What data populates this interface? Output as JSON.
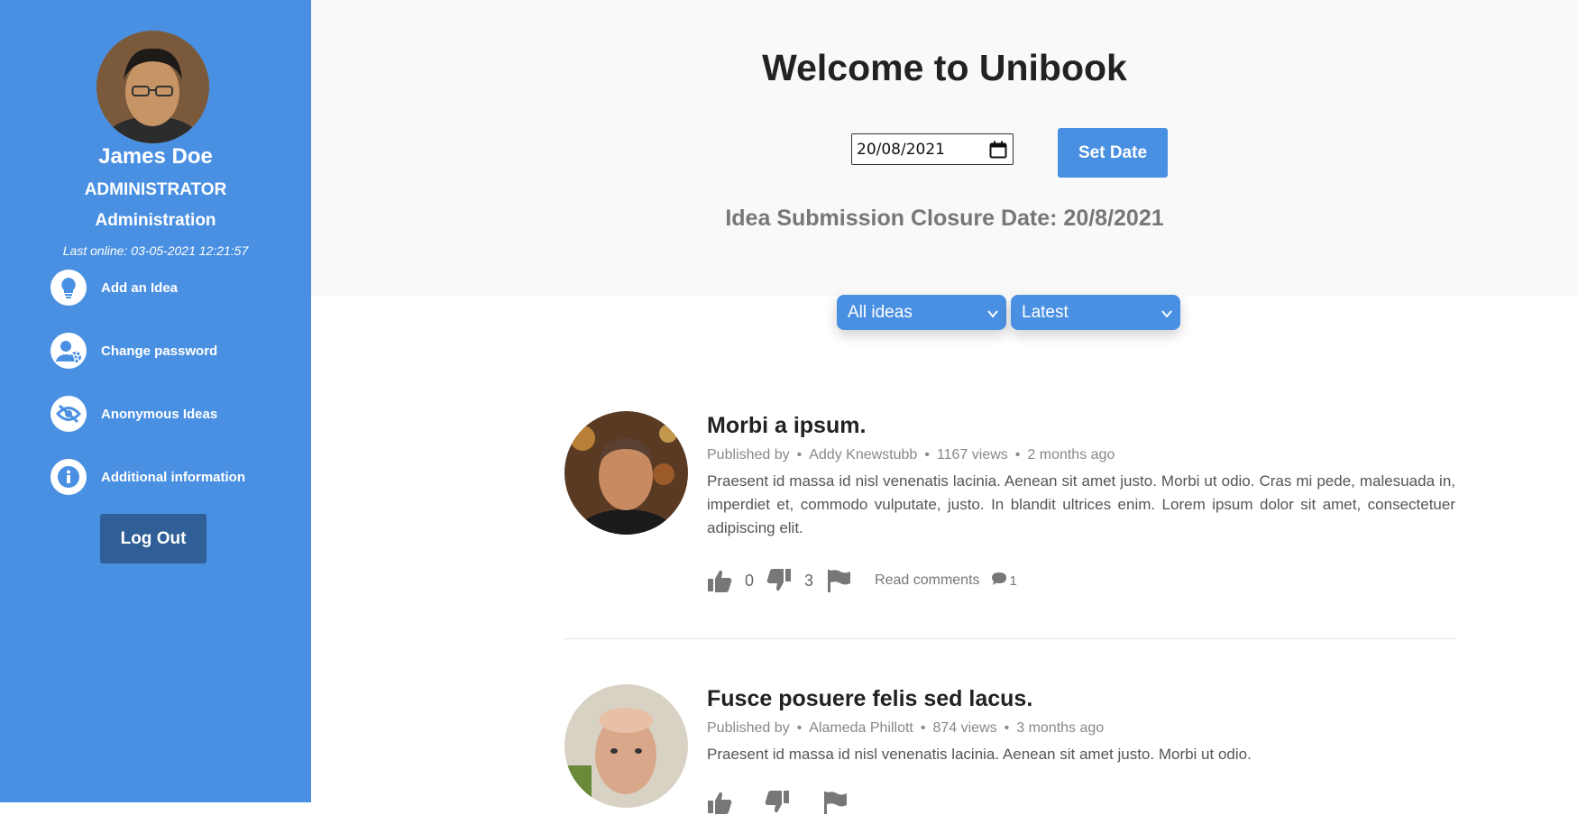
{
  "user": {
    "name": "James Doe",
    "role": "ADMINISTRATOR",
    "department": "Administration",
    "last_online": "Last online: 03-05-2021 12:21:57"
  },
  "menu": [
    {
      "label": "Add an Idea",
      "icon": "lightbulb-icon"
    },
    {
      "label": "Change password",
      "icon": "user-gear-icon"
    },
    {
      "label": "Anonymous Ideas",
      "icon": "eye-slash-icon"
    },
    {
      "label": "Additional information",
      "icon": "info-icon"
    }
  ],
  "logout_label": "Log Out",
  "header": {
    "title": "Welcome to Unibook",
    "date_value": "20/08/2021",
    "set_date_label": "Set Date",
    "closure_text": "Idea Submission Closure Date: 20/8/2021"
  },
  "filters": {
    "category": "All ideas",
    "sort": "Latest"
  },
  "posts": [
    {
      "title": "Morbi a ipsum.",
      "published_by": "Published by",
      "author": "Addy Knewstubb",
      "views": "1167 views",
      "age": "2 months ago",
      "body": "Praesent id massa id nisl venenatis lacinia. Aenean sit amet justo. Morbi ut odio. Cras mi pede, malesuada in, imperdiet et, commodo vulputate, justo. In blandit ultrices enim. Lorem ipsum dolor sit amet, consectetuer adipiscing elit.",
      "likes": "0",
      "dislikes": "3",
      "read_comments": "Read comments",
      "comments": "1"
    },
    {
      "title": "Fusce posuere felis sed lacus.",
      "published_by": "Published by",
      "author": "Alameda Phillott",
      "views": "874 views",
      "age": "3 months ago",
      "body": "Praesent id massa id nisl venenatis lacinia. Aenean sit amet justo. Morbi ut odio."
    }
  ],
  "colors": {
    "sidebar": "#4a90e2",
    "logout": "#2f5f96",
    "header_bg": "#f9f9f9"
  }
}
